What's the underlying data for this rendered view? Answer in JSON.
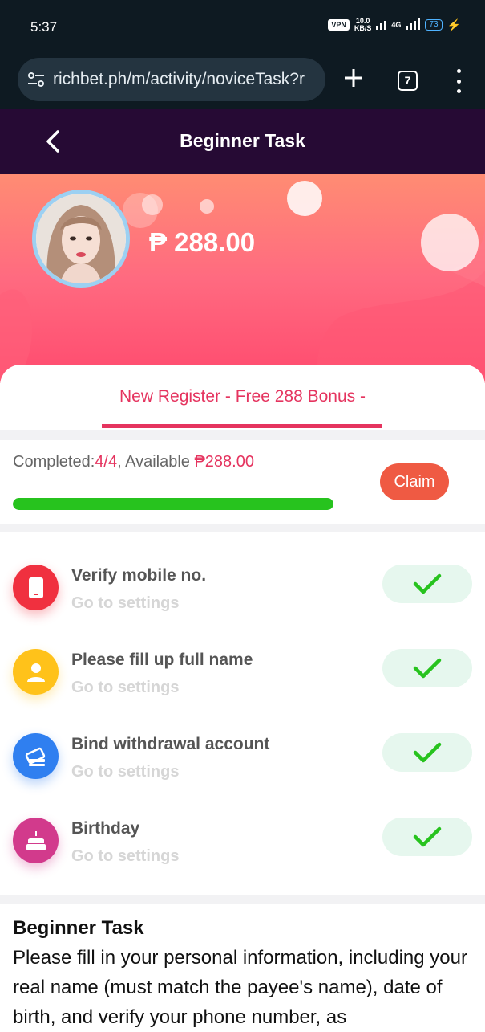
{
  "status_bar": {
    "time": "5:37",
    "vpn": "VPN",
    "net_speed_value": "10.0",
    "net_speed_unit": "KB/S",
    "network": "4G",
    "battery": "73"
  },
  "browser": {
    "url": "richbet.ph/m/activity/noviceTask?r",
    "tab_count": "7",
    "icons": [
      "site-settings-icon",
      "add-tab-icon",
      "tab-switcher-icon",
      "more-menu-icon"
    ]
  },
  "header": {
    "title": "Beginner Task"
  },
  "hero": {
    "balance": "₱ 288.00"
  },
  "tabs": {
    "active_label": "New Register - Free 288 Bonus -"
  },
  "progress": {
    "completed_label": "Completed:",
    "completed_value": "4/4",
    "available_label": ", Available ",
    "available_value": "₱288.00",
    "claim_label": "Claim",
    "fraction": 1.0
  },
  "tasks": [
    {
      "title": "Verify mobile no.",
      "subtitle": "Go to settings",
      "icon": "phone-icon",
      "color": "#f0303f"
    },
    {
      "title": "Please fill up full name",
      "subtitle": "Go to settings",
      "icon": "user-icon",
      "color": "#ffc21a"
    },
    {
      "title": "Bind withdrawal account",
      "subtitle": "Go to settings",
      "icon": "card-icon",
      "color": "#2f7ff0"
    },
    {
      "title": "Birthday",
      "subtitle": "Go to settings",
      "icon": "cake-icon",
      "color": "#d23a8c"
    }
  ],
  "description": {
    "title": "Beginner Task",
    "body": "Please fill in your personal information, including your real name (must match the payee's name), date of birth, and verify your phone number, as"
  },
  "colors": {
    "accent": "#e5345f",
    "header_bg": "#260a34",
    "claim": "#ef5a43",
    "progress": "#27c31e",
    "check": "#27c31e"
  }
}
